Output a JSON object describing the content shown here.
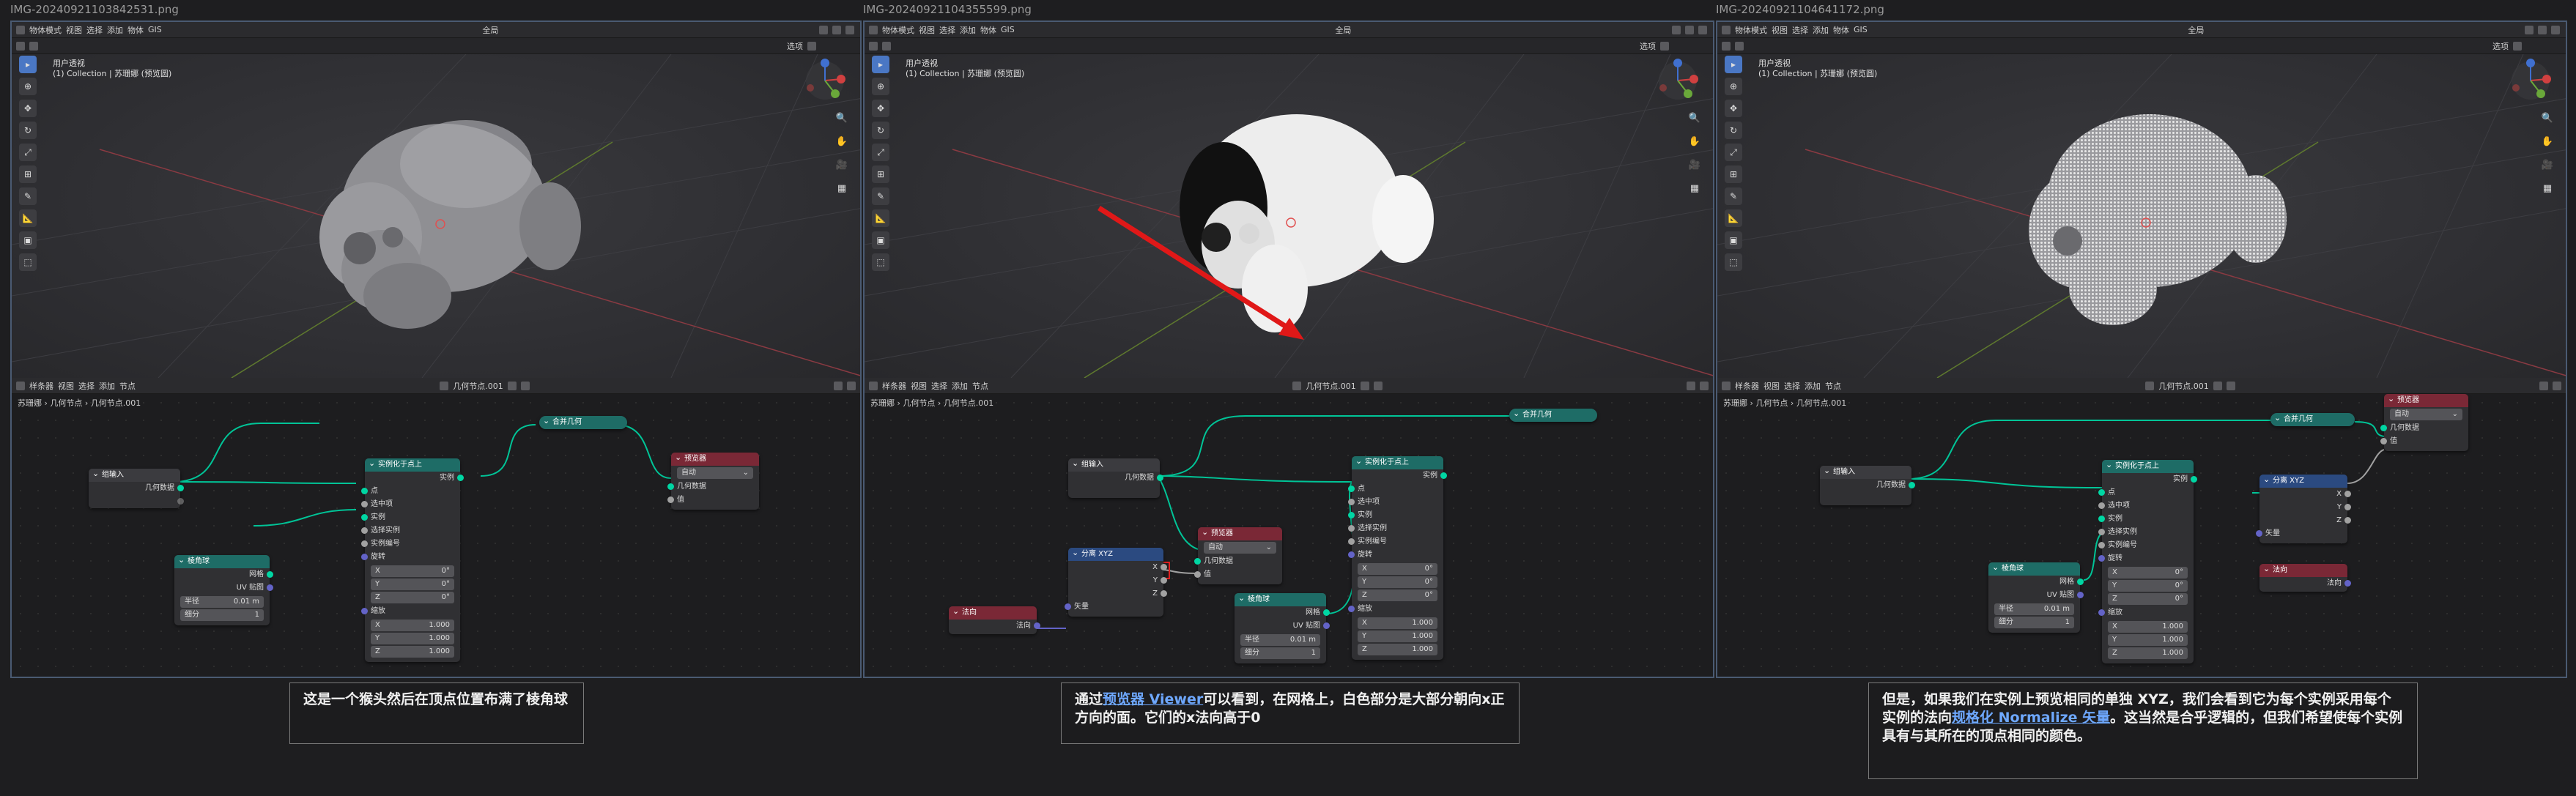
{
  "panels": [
    {
      "filename": "IMG-20240921103842531.png",
      "header": {
        "mode": "物体模式",
        "menus": [
          "视图",
          "选择",
          "添加",
          "物体",
          "GIS"
        ],
        "global": "全局",
        "select": "选项"
      },
      "viewport": {
        "view_name": "用户透视",
        "collection": "(1) Collection | 苏珊娜 (预览圆)"
      },
      "node_header": {
        "editor": "样条器",
        "menus": [
          "视图",
          "选择",
          "添加",
          "节点"
        ],
        "tree": "几何节点.001"
      },
      "breadcrumb": [
        "苏珊娜",
        "几何节点",
        "几何节点.001"
      ],
      "nodes": {
        "input": {
          "title": "组输入",
          "out": "几何数据"
        },
        "instance": {
          "title": "实例化于点上",
          "out": "实例",
          "rows": [
            "点",
            "选中项",
            "实例",
            "选择实例",
            "实例编号",
            "旋转"
          ],
          "rot": [
            [
              "X",
              "0°"
            ],
            [
              "Y",
              "0°"
            ],
            [
              "Z",
              "0°"
            ]
          ],
          "scale_label": "缩放",
          "scale": [
            [
              "X",
              "1.000"
            ],
            [
              "Y",
              "1.000"
            ],
            [
              "Z",
              "1.000"
            ]
          ]
        },
        "ico": {
          "title": "棱角球",
          "out1": "网格",
          "out2": "UV 贴图",
          "f1": [
            "半径",
            "0.01 m"
          ],
          "f2": [
            "细分",
            "1"
          ]
        },
        "join": {
          "title": "合并几何"
        },
        "viewer": {
          "title": "预览器",
          "dropdown": "自动",
          "r1": "几何数据",
          "r2": "值"
        }
      }
    },
    {
      "filename": "IMG-20240921104355599.png",
      "header": {
        "mode": "物体模式",
        "menus": [
          "视图",
          "选择",
          "添加",
          "物体",
          "GIS"
        ],
        "global": "全局",
        "select": "选项"
      },
      "viewport": {
        "view_name": "用户透视",
        "collection": "(1) Collection | 苏珊娜 (预览圆)"
      },
      "node_header": {
        "editor": "样条器",
        "menus": [
          "视图",
          "选择",
          "添加",
          "节点"
        ],
        "tree": "几何节点.001"
      },
      "breadcrumb": [
        "苏珊娜",
        "几何节点",
        "几何节点.001"
      ],
      "nodes": {
        "input": {
          "title": "组输入",
          "out": "几何数据"
        },
        "instance": {
          "title": "实例化于点上",
          "out": "实例",
          "rows": [
            "点",
            "选中项",
            "实例",
            "选择实例",
            "实例编号",
            "旋转"
          ],
          "rot": [
            [
              "X",
              "0°"
            ],
            [
              "Y",
              "0°"
            ],
            [
              "Z",
              "0°"
            ]
          ],
          "scale_label": "缩放",
          "scale": [
            [
              "X",
              "1.000"
            ],
            [
              "Y",
              "1.000"
            ],
            [
              "Z",
              "1.000"
            ]
          ]
        },
        "ico": {
          "title": "棱角球",
          "out1": "网格",
          "out2": "UV 贴图",
          "f1": [
            "半径",
            "0.01 m"
          ],
          "f2": [
            "细分",
            "1"
          ]
        },
        "join": {
          "title": "合并几何"
        },
        "viewer": {
          "title": "预览器",
          "dropdown": "自动",
          "r1": "几何数据",
          "r2": "值"
        },
        "sep": {
          "title": "分离 XYZ",
          "x": "X",
          "y": "Y",
          "z": "Z",
          "in": "矢量"
        },
        "normal": {
          "title": "法向",
          "out": "法向"
        }
      }
    },
    {
      "filename": "IMG-20240921104641172.png",
      "header": {
        "mode": "物体模式",
        "menus": [
          "视图",
          "选择",
          "添加",
          "物体",
          "GIS"
        ],
        "global": "全局",
        "select": "选项"
      },
      "viewport": {
        "view_name": "用户透视",
        "collection": "(1) Collection | 苏珊娜 (预览圆)"
      },
      "node_header": {
        "editor": "样条器",
        "menus": [
          "视图",
          "选择",
          "添加",
          "节点"
        ],
        "tree": "几何节点.001"
      },
      "breadcrumb": [
        "苏珊娜",
        "几何节点",
        "几何节点.001"
      ],
      "nodes": {
        "input": {
          "title": "组输入",
          "out": "几何数据"
        },
        "instance": {
          "title": "实例化于点上",
          "out": "实例",
          "rows": [
            "点",
            "选中项",
            "实例",
            "选择实例",
            "实例编号",
            "旋转"
          ],
          "rot": [
            [
              "X",
              "0°"
            ],
            [
              "Y",
              "0°"
            ],
            [
              "Z",
              "0°"
            ]
          ],
          "scale_label": "缩放",
          "scale": [
            [
              "X",
              "1.000"
            ],
            [
              "Y",
              "1.000"
            ],
            [
              "Z",
              "1.000"
            ]
          ]
        },
        "ico": {
          "title": "棱角球",
          "out1": "网格",
          "out2": "UV 贴图",
          "f1": [
            "半径",
            "0.01 m"
          ],
          "f2": [
            "细分",
            "1"
          ]
        },
        "join": {
          "title": "合并几何"
        },
        "viewer": {
          "title": "预览器",
          "dropdown": "自动",
          "r1": "几何数据",
          "r2": "值"
        },
        "sep": {
          "title": "分离 XYZ",
          "x": "X",
          "y": "Y",
          "z": "Z",
          "in": "矢量"
        },
        "normal": {
          "title": "法向",
          "out": "法向"
        }
      }
    }
  ],
  "captions": [
    {
      "text": "这是一个猴头然后在顶点位置布满了棱角球"
    },
    {
      "pre": "通过",
      "link": "预览器 Viewer",
      "post": "可以看到，在网格上，白色部分是大部分朝向x正方向的面。它们的x法向高于0"
    },
    {
      "pre": "但是，如果我们在实例上预览相同的单独 XYZ，我们会看到它为每个实例采用每个实例的法向",
      "link": "规格化 Normalize 矢量",
      "post": "。这当然是合乎逻辑的，但我们希望使每个实例具有与其所在的顶点相同的颜色。"
    }
  ],
  "colors": {
    "panel_border": "#4a5a72",
    "accent": "#4a77c4",
    "link": "#6ea8ff",
    "arrow": "#e01818"
  }
}
